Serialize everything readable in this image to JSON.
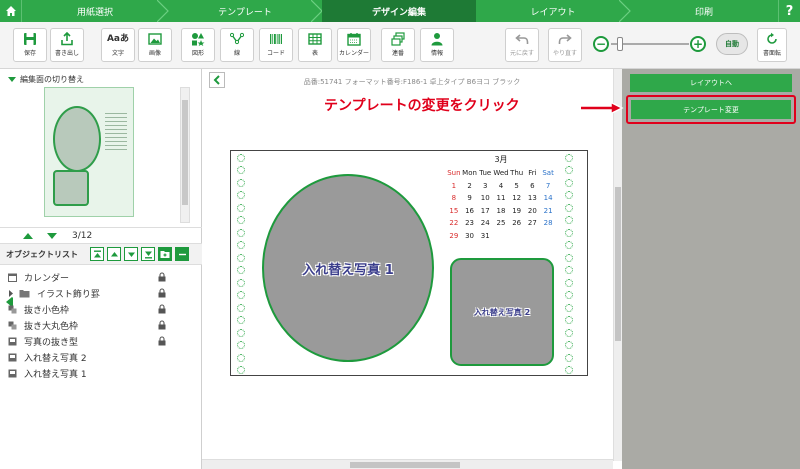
{
  "steps": [
    {
      "label": "用紙選択",
      "active": false
    },
    {
      "label": "テンプレート",
      "active": false
    },
    {
      "label": "デザイン編集",
      "active": true
    },
    {
      "label": "レイアウト",
      "active": false
    },
    {
      "label": "印刷",
      "active": false
    }
  ],
  "help_label": "?",
  "toolbar": {
    "tools": [
      {
        "label": "保存",
        "icon": "save-icon"
      },
      {
        "label": "書き出し",
        "icon": "export-icon"
      },
      {
        "label": "文字",
        "icon": "text-icon",
        "glyph": "Aaあ"
      },
      {
        "label": "画像",
        "icon": "image-icon"
      },
      {
        "label": "図形",
        "icon": "shapes-icon"
      },
      {
        "label": "線",
        "icon": "line-icon"
      },
      {
        "label": "コード",
        "icon": "barcode-icon"
      },
      {
        "label": "表",
        "icon": "table-icon"
      },
      {
        "label": "カレンダー",
        "icon": "calendar-icon"
      },
      {
        "label": "連番",
        "icon": "serial-number-icon"
      },
      {
        "label": "情報",
        "icon": "person-info-icon"
      }
    ],
    "undo_label": "元に戻す",
    "redo_label": "やり直す",
    "zoom_minus": "−",
    "zoom_plus": "+",
    "auto_label": "自動",
    "rotate_label": "書面転"
  },
  "left_panel": {
    "title": "編集面の切り替え",
    "page_indicator": "3/12",
    "object_list_title": "オブジェクトリスト",
    "objects": [
      {
        "label": "カレンダー",
        "icon": "calendar-icon",
        "locked": true
      },
      {
        "label": "イラスト飾り罫",
        "icon": "folder-icon",
        "locked": true,
        "folder": true
      },
      {
        "label": "抜き小色枠",
        "icon": "shape-icon",
        "locked": true
      },
      {
        "label": "抜き大丸色枠",
        "icon": "shape-icon",
        "locked": true
      },
      {
        "label": "写真の抜き型",
        "icon": "image-icon",
        "locked": true
      },
      {
        "label": "入れ替え写真 2",
        "icon": "image-icon",
        "locked": false
      },
      {
        "label": "入れ替え写真 1",
        "icon": "image-icon",
        "locked": false
      }
    ]
  },
  "canvas": {
    "info": "品番:51741 フォーマット番号:F186-1 卓上タイプ B6ヨコ ブラック",
    "photo1_label": "入れ替え写真 1",
    "photo2_label": "入れ替え写真 2",
    "calendar": {
      "month": "3月",
      "weekdays": [
        "Sun",
        "Mon",
        "Tue",
        "Wed",
        "Thu",
        "Fri",
        "Sat"
      ],
      "weeks": [
        [
          "1",
          "2",
          "3",
          "4",
          "5",
          "6",
          "7"
        ],
        [
          "8",
          "9",
          "10",
          "11",
          "12",
          "13",
          "14"
        ],
        [
          "15",
          "16",
          "17",
          "18",
          "19",
          "20",
          "21"
        ],
        [
          "22",
          "23",
          "24",
          "25",
          "26",
          "27",
          "28"
        ],
        [
          "29",
          "30",
          "31",
          "",
          "",
          "",
          ""
        ]
      ]
    }
  },
  "right_panel": {
    "layout_button": "レイアウトへ",
    "change_template_button": "テンプレート変更"
  },
  "annotation": "テンプレートの変更をクリック",
  "colors": {
    "brand_green": "#2fa84a",
    "dark_green": "#1e7a35",
    "annotation_red": "#e0001b",
    "sunday_red": "#d92b2b",
    "saturday_blue": "#2b72c9"
  }
}
